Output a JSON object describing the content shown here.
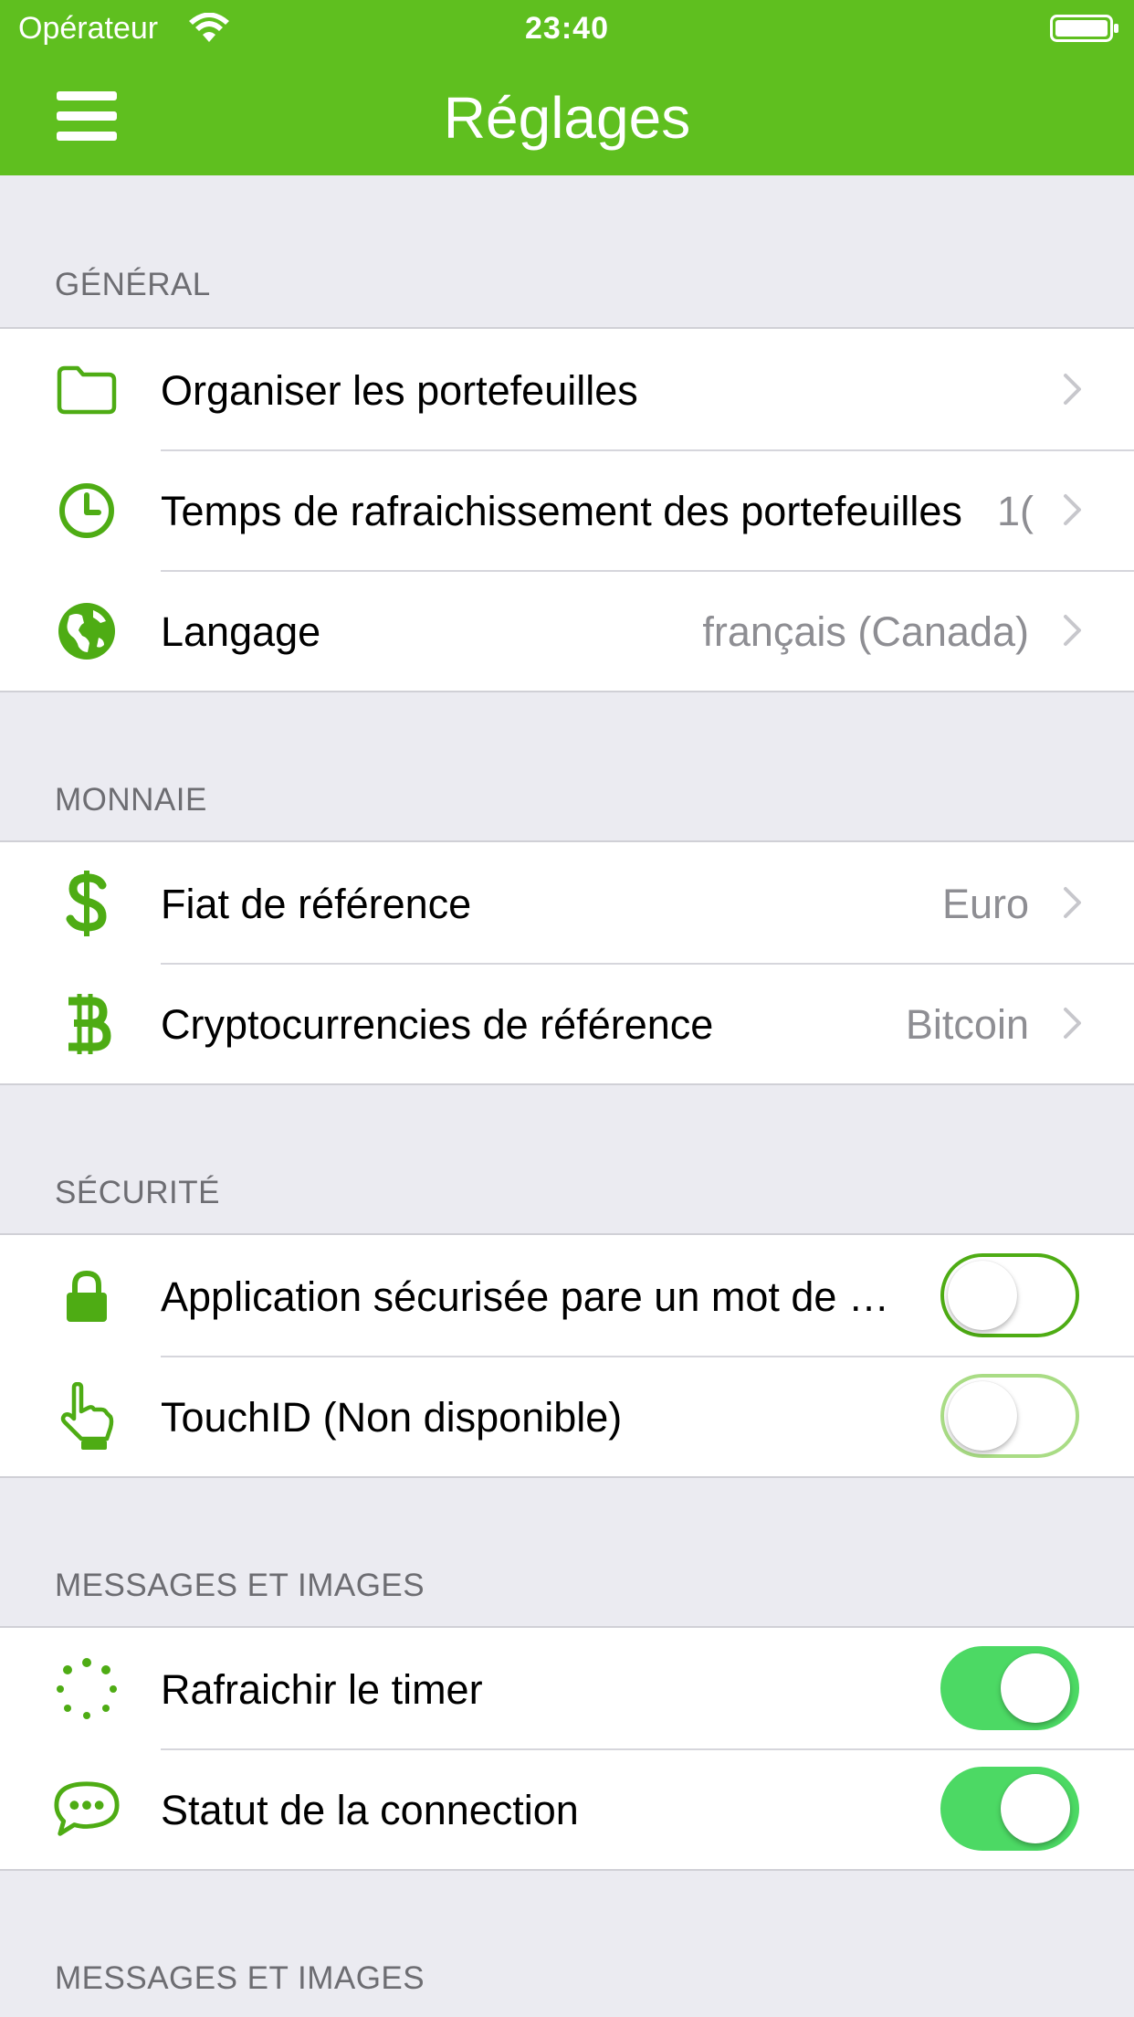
{
  "status_bar": {
    "carrier": "Opérateur",
    "time": "23:40"
  },
  "nav": {
    "title": "Réglages"
  },
  "colors": {
    "accent": "#5fbf1f",
    "toggle_on": "#4cd964",
    "background": "#ebebf1"
  },
  "sections": [
    {
      "header": "GÉNÉRAL",
      "rows": [
        {
          "icon": "folder-icon",
          "label": "Organiser les portefeuilles",
          "value": "",
          "type": "disclosure"
        },
        {
          "icon": "clock-icon",
          "label": "Temps de rafraichissement des portefeuilles",
          "value": "1(",
          "type": "disclosure"
        },
        {
          "icon": "globe-icon",
          "label": "Langage",
          "value": "français (Canada)",
          "type": "disclosure"
        }
      ]
    },
    {
      "header": "MONNAIE",
      "rows": [
        {
          "icon": "dollar-icon",
          "label": "Fiat de référence",
          "value": "Euro",
          "type": "disclosure"
        },
        {
          "icon": "bitcoin-icon",
          "label": "Cryptocurrencies de référence",
          "value": "Bitcoin",
          "type": "disclosure"
        }
      ]
    },
    {
      "header": "SÉCURITÉ",
      "rows": [
        {
          "icon": "lock-icon",
          "label": "Application sécurisée pare un mot de passe",
          "type": "toggle",
          "on": false,
          "enabled": true
        },
        {
          "icon": "touch-hand-icon",
          "label": "TouchID (Non disponible)",
          "type": "toggle",
          "on": false,
          "enabled": false
        }
      ]
    },
    {
      "header": "MESSAGES ET IMAGES",
      "rows": [
        {
          "icon": "spinner-icon",
          "label": "Rafraichir le timer",
          "type": "toggle",
          "on": true,
          "enabled": true
        },
        {
          "icon": "chat-bubble-icon",
          "label": "Statut de la connection",
          "type": "toggle",
          "on": true,
          "enabled": true
        }
      ]
    },
    {
      "header": "MESSAGES ET IMAGES",
      "rows": []
    }
  ]
}
